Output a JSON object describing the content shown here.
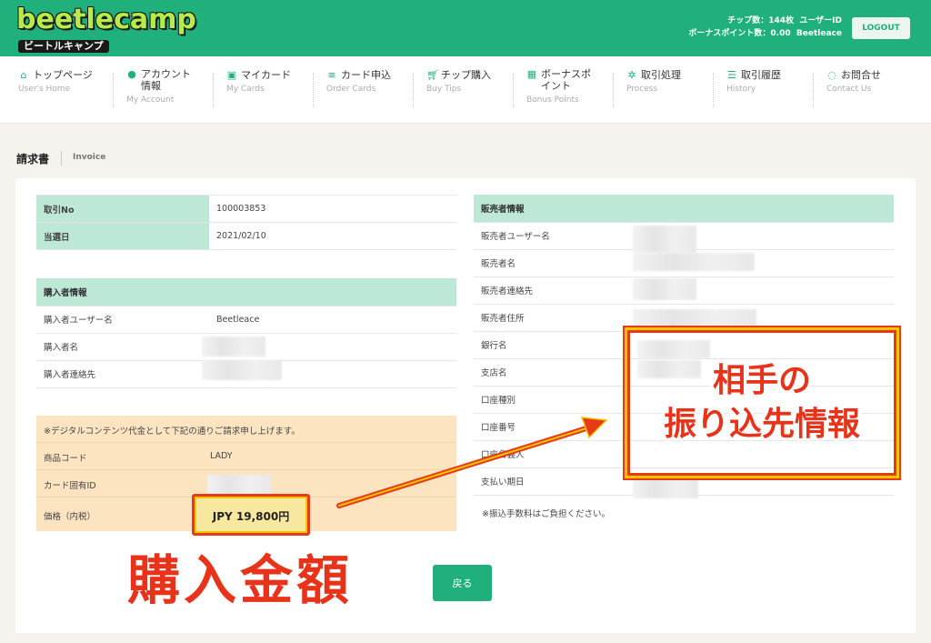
{
  "header": {
    "logo_main": "beetlecamp",
    "logo_sub": "ビートルキャンプ",
    "chips": "チップ数：144枚",
    "user_id": "ユーザーID",
    "bonus_points": "ボーナスポイント数：0.00",
    "username": "Beetleace",
    "logout_label": "LOGOUT"
  },
  "nav": [
    {
      "ja": "トップページ",
      "en": "User's Home",
      "icon": "home-icon"
    },
    {
      "ja": "アカウント情報",
      "en": "My Account",
      "icon": "user-icon"
    },
    {
      "ja": "マイカード",
      "en": "My Cards",
      "icon": "card-icon"
    },
    {
      "ja": "カード申込",
      "en": "Order Cards",
      "icon": "coins-icon"
    },
    {
      "ja": "チップ購入",
      "en": "Buy Tips",
      "icon": "cart-icon"
    },
    {
      "ja": "ボーナスポイント",
      "en": "Bonus Points",
      "icon": "gift-icon"
    },
    {
      "ja": "取引処理",
      "en": "Process",
      "icon": "spinner-icon"
    },
    {
      "ja": "取引履歴",
      "en": "History",
      "icon": "list-icon"
    },
    {
      "ja": "お問合せ",
      "en": "Contact Us",
      "icon": "chat-icon"
    }
  ],
  "page": {
    "title": "請求書",
    "title_en": "Invoice"
  },
  "transaction": {
    "no_label": "取引No",
    "no_value": "100003853",
    "date_label": "当選日",
    "date_value": "2021/02/10"
  },
  "buyer": {
    "heading": "購入者情報",
    "username_label": "購入者ユーザー名",
    "username_value": "Beetleace",
    "name_label": "購入者名",
    "contact_label": "購入者連絡先"
  },
  "order": {
    "notice": "※デジタルコンテンツ代金として下記の通りご請求申し上げます。",
    "product_code_label": "商品コード",
    "product_code_value": "LADY",
    "card_id_label": "カード固有ID",
    "price_label": "価格（内税）",
    "price_value": "JPY 19,800円"
  },
  "seller": {
    "heading": "販売者情報",
    "rows": [
      "販売者ユーザー名",
      "販売者名",
      "販売者連絡先",
      "販売者住所",
      "銀行名",
      "支店名",
      "口座種別",
      "口座番号",
      "口座名義人",
      "支払い期日"
    ],
    "fee_note": "※振込手数料はご負担ください。"
  },
  "back_label": "戻る",
  "annotations": {
    "right_line1": "相手の",
    "right_line2": "振り込先情報",
    "left": "購入金額"
  },
  "colors": {
    "primary": "#1fb07b",
    "table_header": "#bde8d6",
    "order_bg": "#fce4c0",
    "annotation_red": "#e53b1a",
    "annotation_yellow": "#f5c400"
  }
}
